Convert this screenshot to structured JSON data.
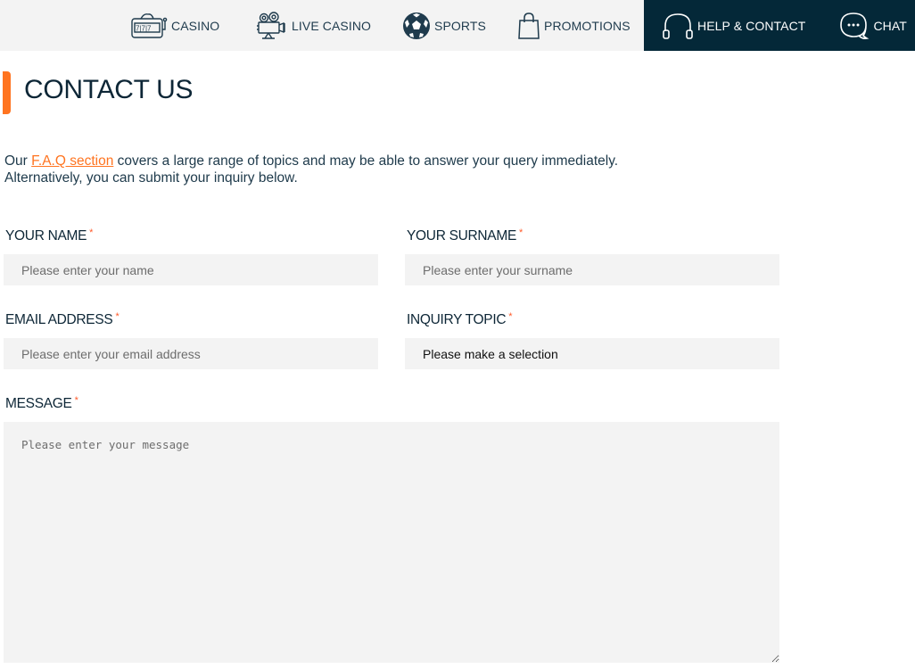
{
  "nav": {
    "items": [
      {
        "label": "CASINO",
        "icon": "slot-machine-icon",
        "active": false
      },
      {
        "label": "LIVE CASINO",
        "icon": "movie-camera-icon",
        "active": false
      },
      {
        "label": "SPORTS",
        "icon": "soccer-ball-icon",
        "active": false
      },
      {
        "label": "PROMOTIONS",
        "icon": "shopping-bag-icon",
        "active": false
      },
      {
        "label": "HELP & CONTACT",
        "icon": "headphones-icon",
        "active": true
      },
      {
        "label": "CHAT",
        "icon": "chat-bubble-icon",
        "active": false
      }
    ]
  },
  "page": {
    "title": "CONTACT US",
    "intro_prefix": "Our ",
    "faq_link": "F.A.Q section",
    "intro_suffix": " covers a large range of topics and may be able to answer your query immediately.",
    "intro_line2": "Alternatively, you can submit your inquiry below."
  },
  "form": {
    "required_mark": "*",
    "name": {
      "label": "YOUR NAME",
      "placeholder": "Please enter your name",
      "value": ""
    },
    "surname": {
      "label": "YOUR SURNAME",
      "placeholder": "Please enter your surname",
      "value": ""
    },
    "email": {
      "label": "EMAIL ADDRESS",
      "placeholder": "Please enter your email address",
      "value": ""
    },
    "topic": {
      "label": "INQUIRY TOPIC",
      "selected": "Please make a selection"
    },
    "message": {
      "label": "MESSAGE",
      "placeholder": "Please enter your message",
      "value": ""
    }
  },
  "colors": {
    "accent": "#ff7420",
    "nav_active_bg": "#042838",
    "nav_bg": "#f3f3f3",
    "field_bg": "#f3f3f3",
    "text_dark": "#0d2636"
  }
}
